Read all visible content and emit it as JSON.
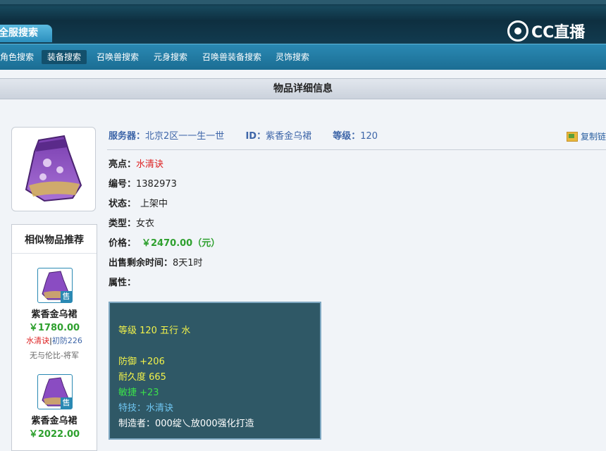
{
  "header": {
    "site_tab": "全服搜索",
    "logo_text": "CC直播",
    "nav": [
      {
        "label": "角色搜索",
        "active": false
      },
      {
        "label": "装备搜索",
        "active": true
      },
      {
        "label": "召唤兽搜索",
        "active": false
      },
      {
        "label": "元身搜索",
        "active": false
      },
      {
        "label": "召唤兽装备搜索",
        "active": false
      },
      {
        "label": "灵饰搜索",
        "active": false
      }
    ]
  },
  "page_title": "物品详细信息",
  "item": {
    "server_label": "服务器：",
    "server_value": "北京2区一一生一世",
    "id_label": "ID：",
    "id_value": "紫香金乌裙",
    "level_label": "等级：",
    "level_value": "120",
    "copy_link": "复制链",
    "highlight_label": "亮点：",
    "highlight_value": "水清诀",
    "number_label": "编号：",
    "number_value": "1382973",
    "status_label": "状态：",
    "status_value": "上架中",
    "type_label": "类型：",
    "type_value": "女衣",
    "price_label": "价格：",
    "price_value": "￥2470.00（元）",
    "remaining_label": "出售剩余时间：",
    "remaining_value": "8天1时",
    "attrs_label": "属性："
  },
  "attributes": {
    "level_line": "等级 120 五行 水",
    "defense": "防御 +206",
    "durability": "耐久度 665",
    "agility": "敏捷 +23",
    "skill": "特技：水清诀",
    "maker": "制造者：000绽乀放000强化打造",
    "colors": {
      "yellow": "#f2f24a",
      "green": "#3be04a",
      "skill": "#6fc6f2",
      "white": "#ffffff"
    }
  },
  "similar": {
    "title": "相似物品推荐",
    "sold_tag": "售",
    "items": [
      {
        "name": "紫香金乌裙",
        "price": "￥1780.00",
        "tag1": "水清诀",
        "tag2": "初防226",
        "seller": "无与伦比-将军"
      },
      {
        "name": "紫香金乌裙",
        "price": "￥2022.00"
      }
    ]
  }
}
